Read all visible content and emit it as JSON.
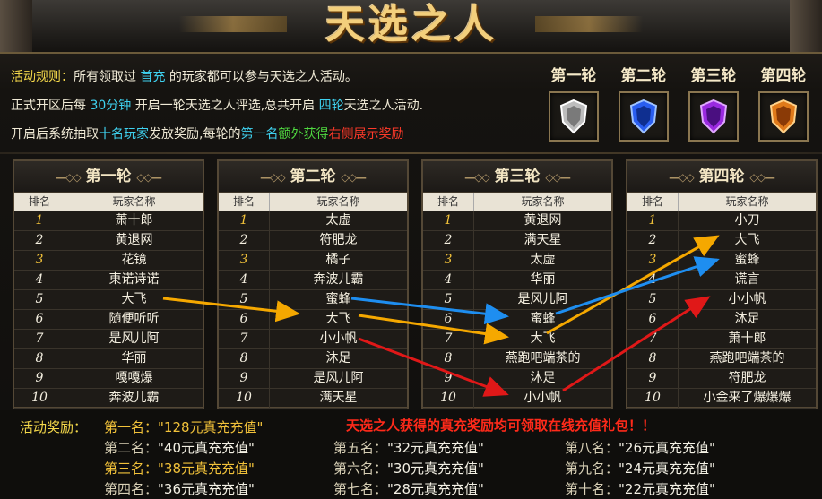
{
  "banner": {
    "title": "天选之人"
  },
  "rules": {
    "line1": {
      "p1": "活动规则：",
      "p2": "所有领取过",
      "p3": " 首充 ",
      "p4": "的玩家都可以参与天选之人活动。"
    },
    "line2": {
      "p1": "正式开区后每 ",
      "p2": "30分钟",
      "p3": " 开启一轮天选之人评选,总共开启 ",
      "p4": "四轮",
      "p5": "天选之人活动."
    },
    "line3": {
      "p1": "开启后系统抽取",
      "p2": "十名玩家",
      "p3": "发放奖励,每轮的",
      "p4": "第一名",
      "p5": "额外获得",
      "p6": "右侧展示奖励"
    }
  },
  "reward_rounds": [
    {
      "label": "第一轮",
      "icon": "silver-shield-icon",
      "color": "#c8c8c8"
    },
    {
      "label": "第二轮",
      "icon": "blue-shield-icon",
      "color": "#2a5ef0"
    },
    {
      "label": "第三轮",
      "icon": "purple-shield-icon",
      "color": "#9a2ae0"
    },
    {
      "label": "第四轮",
      "icon": "orange-shield-icon",
      "color": "#e07a1a"
    }
  ],
  "table_headers": {
    "rank": "排名",
    "player": "玩家名称"
  },
  "rounds": [
    {
      "title": "第一轮",
      "players": [
        "萧十郎",
        "黄退网",
        "花镜",
        "東诺诗诺",
        "大飞",
        "随便听听",
        "是风儿阿",
        "华丽",
        "嘎嘎爆",
        "奔波儿霸"
      ]
    },
    {
      "title": "第二轮",
      "players": [
        "太虚",
        "符肥龙",
        "橘子",
        "奔波儿霸",
        "蜜蜂",
        "大飞",
        "小小帆",
        "沐足",
        "是风儿阿",
        "满天星"
      ]
    },
    {
      "title": "第三轮",
      "players": [
        "黄退网",
        "满天星",
        "太虚",
        "华丽",
        "是风儿阿",
        "蜜蜂",
        "大飞",
        "燕跑吧端茶的",
        "沐足",
        "小小帆"
      ]
    },
    {
      "title": "第四轮",
      "players": [
        "小刀",
        "大飞",
        "蜜蜂",
        "谎言",
        "小小帆",
        "沐足",
        "萧十郎",
        "燕跑吧端茶的",
        "符肥龙",
        "小金来了爆爆爆"
      ]
    }
  ],
  "ranks": [
    "1",
    "2",
    "3",
    "4",
    "5",
    "6",
    "7",
    "8",
    "9",
    "10"
  ],
  "rewards": {
    "title": "活动奖励：",
    "notice": "天选之人获得的真充奖励均可领取在线充值礼包！！",
    "items": [
      {
        "label": "第一名：",
        "value": "\"128元真充充值\""
      },
      {
        "label": "第二名：",
        "value": "\"40元真充充值\""
      },
      {
        "label": "第三名：",
        "value": "\"38元真充充值\""
      },
      {
        "label": "第四名：",
        "value": "\"36元真充充值\""
      },
      {
        "label": "第五名：",
        "value": "\"32元真充充值\""
      },
      {
        "label": "第六名：",
        "value": "\"30元真充充值\""
      },
      {
        "label": "第七名：",
        "value": "\"28元真充充值\""
      },
      {
        "label": "第八名：",
        "value": "\"26元真充充值\""
      },
      {
        "label": "第九名：",
        "value": "\"24元真充充值\""
      },
      {
        "label": "第十名：",
        "value": "\"22元真充充值\""
      }
    ]
  },
  "colors": {
    "arrow_orange": "#f5a800",
    "arrow_blue": "#1e8ef0",
    "arrow_red": "#e01818",
    "gold": "#f2c23a"
  }
}
